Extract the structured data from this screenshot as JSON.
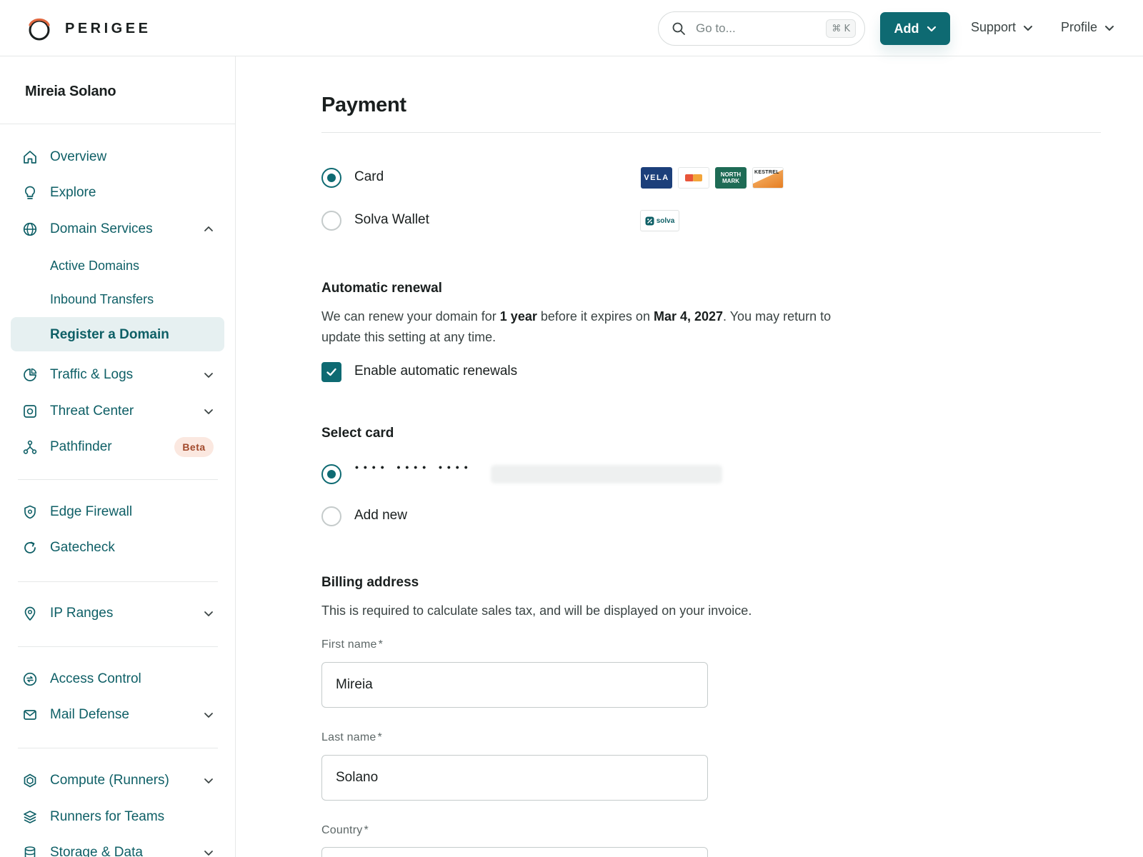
{
  "brand": {
    "name": "PERIGEE"
  },
  "search": {
    "placeholder": "Go to...",
    "shortcut": "⌘ K"
  },
  "header": {
    "add_label": "Add",
    "support_label": "Support",
    "profile_label": "Profile"
  },
  "sidebar": {
    "account_name": "Mireia Solano",
    "items": {
      "overview": "Overview",
      "explore": "Explore",
      "domain_services": "Domain Services",
      "active_domains": "Active Domains",
      "inbound_transfers": "Inbound Transfers",
      "register_domain": "Register a Domain",
      "traffic_logs": "Traffic & Logs",
      "threat_center": "Threat Center",
      "pathfinder": "Pathfinder",
      "pathfinder_badge": "Beta",
      "edge_firewall": "Edge Firewall",
      "gatecheck": "Gatecheck",
      "ip_ranges": "IP Ranges",
      "access_control": "Access Control",
      "mail_defense": "Mail Defense",
      "compute_runners": "Compute (Runners)",
      "runners_for_teams": "Runners for Teams",
      "storage_data": "Storage & Data"
    }
  },
  "payment": {
    "title": "Payment",
    "methods": {
      "card": "Card",
      "wallet": "Solva Wallet",
      "selected": "card"
    },
    "card_brands": {
      "vela": "VELA",
      "northmark_1": "NORTH",
      "northmark_2": "MARK",
      "kestrel": "KESTREL",
      "solva": "solva"
    }
  },
  "renewal": {
    "heading": "Automatic renewal",
    "text_1": "We can renew your domain for ",
    "term": "1 year",
    "text_2": " before it expires on ",
    "expiry": "Mar 4, 2027",
    "text_3": ". You may return to update this setting at any time.",
    "checkbox_label": "Enable automatic renewals",
    "enabled": true
  },
  "select_card": {
    "heading": "Select card",
    "saved_card_mask": "•••• •••• ••••",
    "add_new_label": "Add new"
  },
  "billing": {
    "heading": "Billing address",
    "description": "This is required to calculate sales tax, and will be displayed on your invoice.",
    "first_name_label": "First name",
    "first_name_value": "Mireia",
    "last_name_label": "Last name",
    "last_name_value": "Solano",
    "country_label": "Country",
    "required_mark": "*"
  },
  "colors": {
    "primary": "#0e6a72",
    "nav_text": "#0e5f66",
    "active_bg": "#e6f0f1",
    "beta_bg": "#fbe8e0",
    "brand_accent": "#e0673f"
  }
}
